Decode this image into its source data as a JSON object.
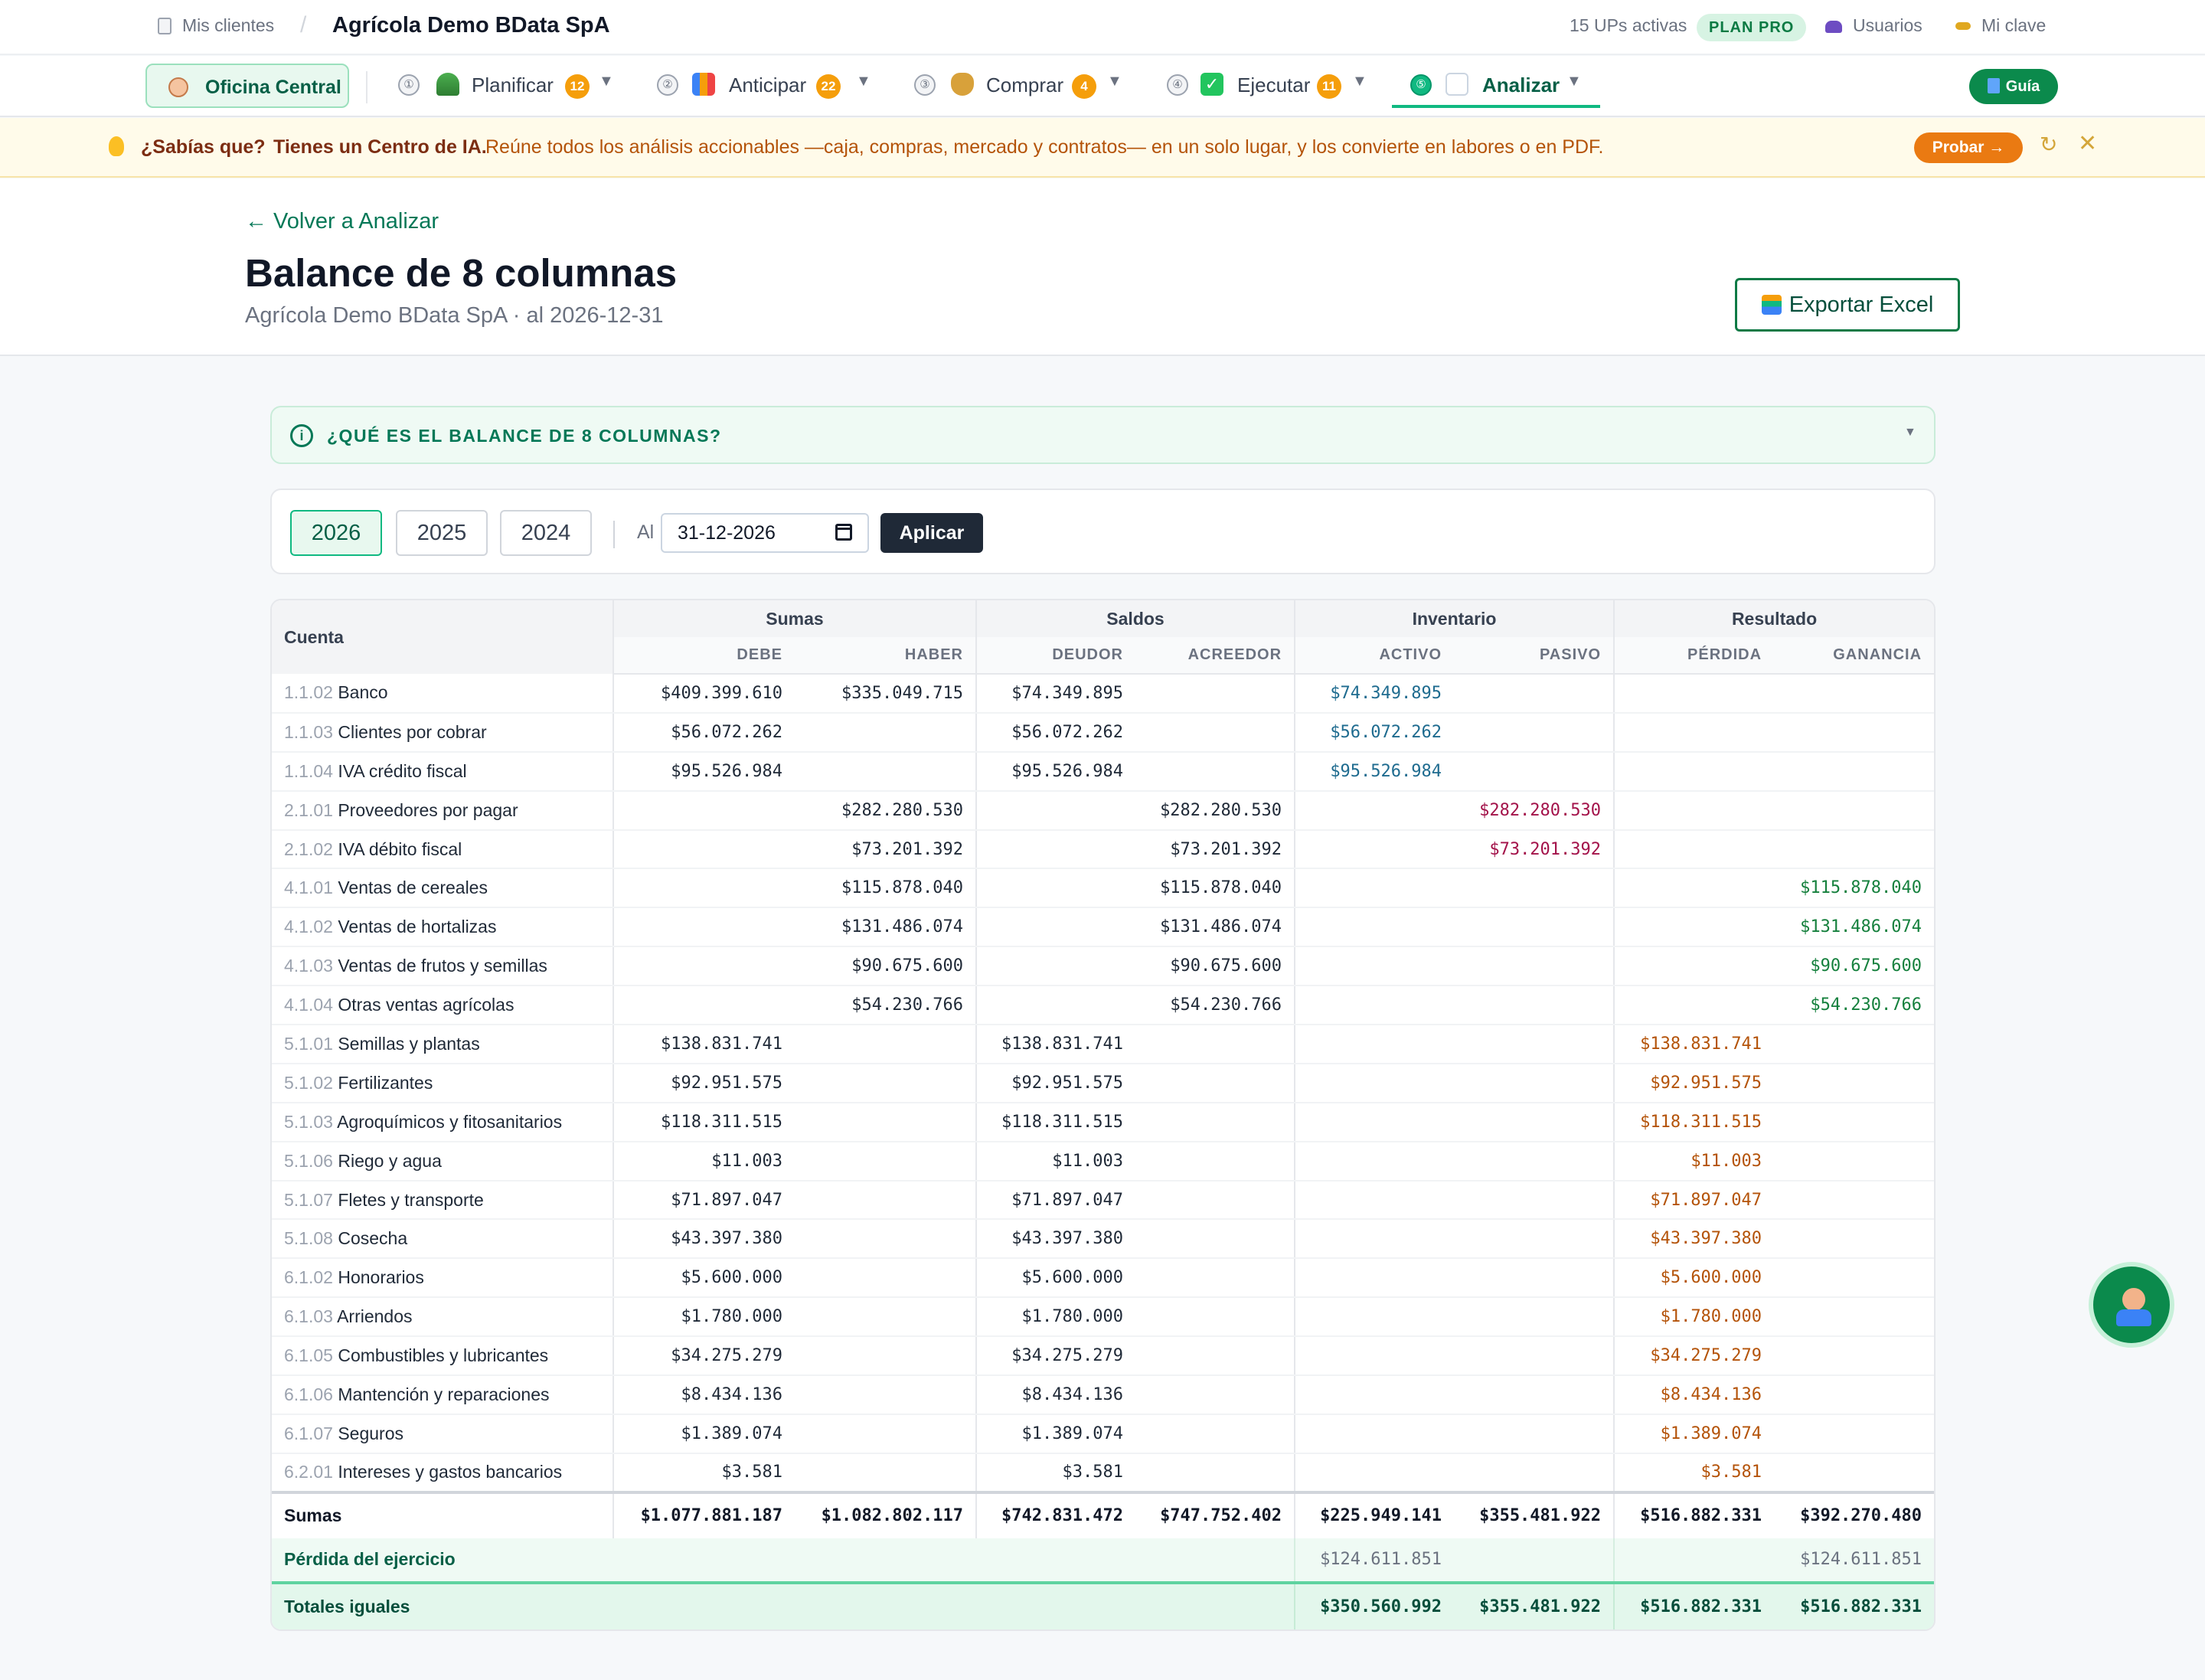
{
  "topbar": {
    "clients_label": "Mis clientes",
    "company": "Agrícola Demo BData SpA",
    "ups_active": "15 UPs activas",
    "plan": "PLAN PRO",
    "users": "Usuarios",
    "password": "Mi clave"
  },
  "nav": {
    "home": "Oficina Central",
    "tabs": [
      {
        "num": "①",
        "label": "Planificar",
        "badge": "12"
      },
      {
        "num": "②",
        "label": "Anticipar",
        "badge": "22"
      },
      {
        "num": "③",
        "label": "Comprar",
        "badge": "4"
      },
      {
        "num": "④",
        "label": "Ejecutar",
        "badge": "11"
      },
      {
        "num": "⑤",
        "label": "Analizar",
        "badge": ""
      }
    ],
    "guide": "Guía"
  },
  "tip": {
    "question": "¿Sabías que?",
    "strong": "Tienes un Centro de IA.",
    "text": "Reúne todos los análisis accionables —caja, compras, mercado y contratos— en un solo lugar, y los convierte en labores o en PDF.",
    "try_label": "Probar →"
  },
  "header": {
    "back": "← Volver a Analizar",
    "title": "Balance de 8 columnas",
    "subtitle": "Agrícola Demo BData SpA · al 2026-12-31",
    "export": "Exportar Excel"
  },
  "info": {
    "label": "¿QUÉ ES EL BALANCE DE 8 COLUMNAS?"
  },
  "filter": {
    "years": [
      "2026",
      "2025",
      "2024"
    ],
    "active_year": "2026",
    "al_label": "Al",
    "date_value": "31-12-2026",
    "apply": "Aplicar"
  },
  "table": {
    "col_account": "Cuenta",
    "groups": [
      "Sumas",
      "Saldos",
      "Inventario",
      "Resultado"
    ],
    "subheaders": [
      "DEBE",
      "HABER",
      "DEUDOR",
      "ACREEDOR",
      "ACTIVO",
      "PASIVO",
      "PÉRDIDA",
      "GANANCIA"
    ],
    "rows": [
      {
        "code": "1.1.02",
        "name": "Banco",
        "debe": "$409.399.610",
        "haber": "$335.049.715",
        "deudor": "$74.349.895",
        "acreedor": "",
        "activo": "$74.349.895",
        "pasivo": "",
        "perdida": "",
        "ganancia": ""
      },
      {
        "code": "1.1.03",
        "name": "Clientes por cobrar",
        "debe": "$56.072.262",
        "haber": "",
        "deudor": "$56.072.262",
        "acreedor": "",
        "activo": "$56.072.262",
        "pasivo": "",
        "perdida": "",
        "ganancia": ""
      },
      {
        "code": "1.1.04",
        "name": "IVA crédito fiscal",
        "debe": "$95.526.984",
        "haber": "",
        "deudor": "$95.526.984",
        "acreedor": "",
        "activo": "$95.526.984",
        "pasivo": "",
        "perdida": "",
        "ganancia": ""
      },
      {
        "code": "2.1.01",
        "name": "Proveedores por pagar",
        "debe": "",
        "haber": "$282.280.530",
        "deudor": "",
        "acreedor": "$282.280.530",
        "activo": "",
        "pasivo": "$282.280.530",
        "perdida": "",
        "ganancia": ""
      },
      {
        "code": "2.1.02",
        "name": "IVA débito fiscal",
        "debe": "",
        "haber": "$73.201.392",
        "deudor": "",
        "acreedor": "$73.201.392",
        "activo": "",
        "pasivo": "$73.201.392",
        "perdida": "",
        "ganancia": ""
      },
      {
        "code": "4.1.01",
        "name": "Ventas de cereales",
        "debe": "",
        "haber": "$115.878.040",
        "deudor": "",
        "acreedor": "$115.878.040",
        "activo": "",
        "pasivo": "",
        "perdida": "",
        "ganancia": "$115.878.040"
      },
      {
        "code": "4.1.02",
        "name": "Ventas de hortalizas",
        "debe": "",
        "haber": "$131.486.074",
        "deudor": "",
        "acreedor": "$131.486.074",
        "activo": "",
        "pasivo": "",
        "perdida": "",
        "ganancia": "$131.486.074"
      },
      {
        "code": "4.1.03",
        "name": "Ventas de frutos y semillas",
        "debe": "",
        "haber": "$90.675.600",
        "deudor": "",
        "acreedor": "$90.675.600",
        "activo": "",
        "pasivo": "",
        "perdida": "",
        "ganancia": "$90.675.600"
      },
      {
        "code": "4.1.04",
        "name": "Otras ventas agrícolas",
        "debe": "",
        "haber": "$54.230.766",
        "deudor": "",
        "acreedor": "$54.230.766",
        "activo": "",
        "pasivo": "",
        "perdida": "",
        "ganancia": "$54.230.766"
      },
      {
        "code": "5.1.01",
        "name": "Semillas y plantas",
        "debe": "$138.831.741",
        "haber": "",
        "deudor": "$138.831.741",
        "acreedor": "",
        "activo": "",
        "pasivo": "",
        "perdida": "$138.831.741",
        "ganancia": ""
      },
      {
        "code": "5.1.02",
        "name": "Fertilizantes",
        "debe": "$92.951.575",
        "haber": "",
        "deudor": "$92.951.575",
        "acreedor": "",
        "activo": "",
        "pasivo": "",
        "perdida": "$92.951.575",
        "ganancia": ""
      },
      {
        "code": "5.1.03",
        "name": "Agroquímicos y fitosanitarios",
        "debe": "$118.311.515",
        "haber": "",
        "deudor": "$118.311.515",
        "acreedor": "",
        "activo": "",
        "pasivo": "",
        "perdida": "$118.311.515",
        "ganancia": ""
      },
      {
        "code": "5.1.06",
        "name": "Riego y agua",
        "debe": "$11.003",
        "haber": "",
        "deudor": "$11.003",
        "acreedor": "",
        "activo": "",
        "pasivo": "",
        "perdida": "$11.003",
        "ganancia": ""
      },
      {
        "code": "5.1.07",
        "name": "Fletes y transporte",
        "debe": "$71.897.047",
        "haber": "",
        "deudor": "$71.897.047",
        "acreedor": "",
        "activo": "",
        "pasivo": "",
        "perdida": "$71.897.047",
        "ganancia": ""
      },
      {
        "code": "5.1.08",
        "name": "Cosecha",
        "debe": "$43.397.380",
        "haber": "",
        "deudor": "$43.397.380",
        "acreedor": "",
        "activo": "",
        "pasivo": "",
        "perdida": "$43.397.380",
        "ganancia": ""
      },
      {
        "code": "6.1.02",
        "name": "Honorarios",
        "debe": "$5.600.000",
        "haber": "",
        "deudor": "$5.600.000",
        "acreedor": "",
        "activo": "",
        "pasivo": "",
        "perdida": "$5.600.000",
        "ganancia": ""
      },
      {
        "code": "6.1.03",
        "name": "Arriendos",
        "debe": "$1.780.000",
        "haber": "",
        "deudor": "$1.780.000",
        "acreedor": "",
        "activo": "",
        "pasivo": "",
        "perdida": "$1.780.000",
        "ganancia": ""
      },
      {
        "code": "6.1.05",
        "name": "Combustibles y lubricantes",
        "debe": "$34.275.279",
        "haber": "",
        "deudor": "$34.275.279",
        "acreedor": "",
        "activo": "",
        "pasivo": "",
        "perdida": "$34.275.279",
        "ganancia": ""
      },
      {
        "code": "6.1.06",
        "name": "Mantención y reparaciones",
        "debe": "$8.434.136",
        "haber": "",
        "deudor": "$8.434.136",
        "acreedor": "",
        "activo": "",
        "pasivo": "",
        "perdida": "$8.434.136",
        "ganancia": ""
      },
      {
        "code": "6.1.07",
        "name": "Seguros",
        "debe": "$1.389.074",
        "haber": "",
        "deudor": "$1.389.074",
        "acreedor": "",
        "activo": "",
        "pasivo": "",
        "perdida": "$1.389.074",
        "ganancia": ""
      },
      {
        "code": "6.2.01",
        "name": "Intereses y gastos bancarios",
        "debe": "$3.581",
        "haber": "",
        "deudor": "$3.581",
        "acreedor": "",
        "activo": "",
        "pasivo": "",
        "perdida": "$3.581",
        "ganancia": ""
      }
    ],
    "sumas": {
      "label": "Sumas",
      "debe": "$1.077.881.187",
      "haber": "$1.082.802.117",
      "deudor": "$742.831.472",
      "acreedor": "$747.752.402",
      "activo": "$225.949.141",
      "pasivo": "$355.481.922",
      "perdida": "$516.882.331",
      "ganancia": "$392.270.480"
    },
    "perdida_ejercicio": {
      "label": "Pérdida del ejercicio",
      "activo": "$124.611.851",
      "ganancia": "$124.611.851"
    },
    "totales": {
      "label": "Totales iguales",
      "activo": "$350.560.992",
      "pasivo": "$355.481.922",
      "perdida": "$516.882.331",
      "ganancia": "$516.882.331"
    }
  }
}
